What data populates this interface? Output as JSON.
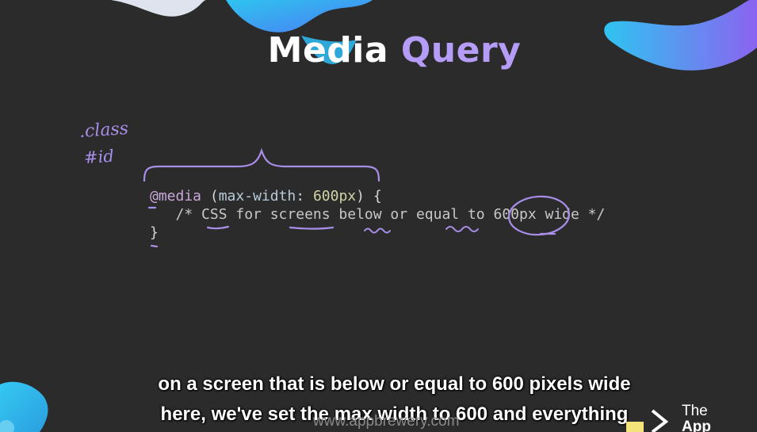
{
  "slide": {
    "title_word1": "Media",
    "title_word2": "Query",
    "hand_note_1": ".class",
    "hand_note_2": "#id"
  },
  "code": {
    "line1": {
      "at_rule": "@media",
      "open_paren": " (",
      "property": "max-width",
      "colon": ": ",
      "value": "600px",
      "close": ") {"
    },
    "line2": "   /* CSS for screens below or equal to 600px wide */",
    "line3": "}"
  },
  "subtitles": {
    "line1": "on a screen that is below or equal to 600 pixels wide",
    "line2": "here, we've set the max width to 600 and everything"
  },
  "watermark": "www.appbrewery.com",
  "brand": {
    "line1": "The",
    "line2": "App Brewe"
  },
  "colors": {
    "background": "#2b2b2b",
    "accent_purple": "#b49cf7",
    "annotation_purple": "#a88ee8",
    "gradient_blue": "#2fc4f0",
    "gradient_violet": "#8a63f0"
  }
}
